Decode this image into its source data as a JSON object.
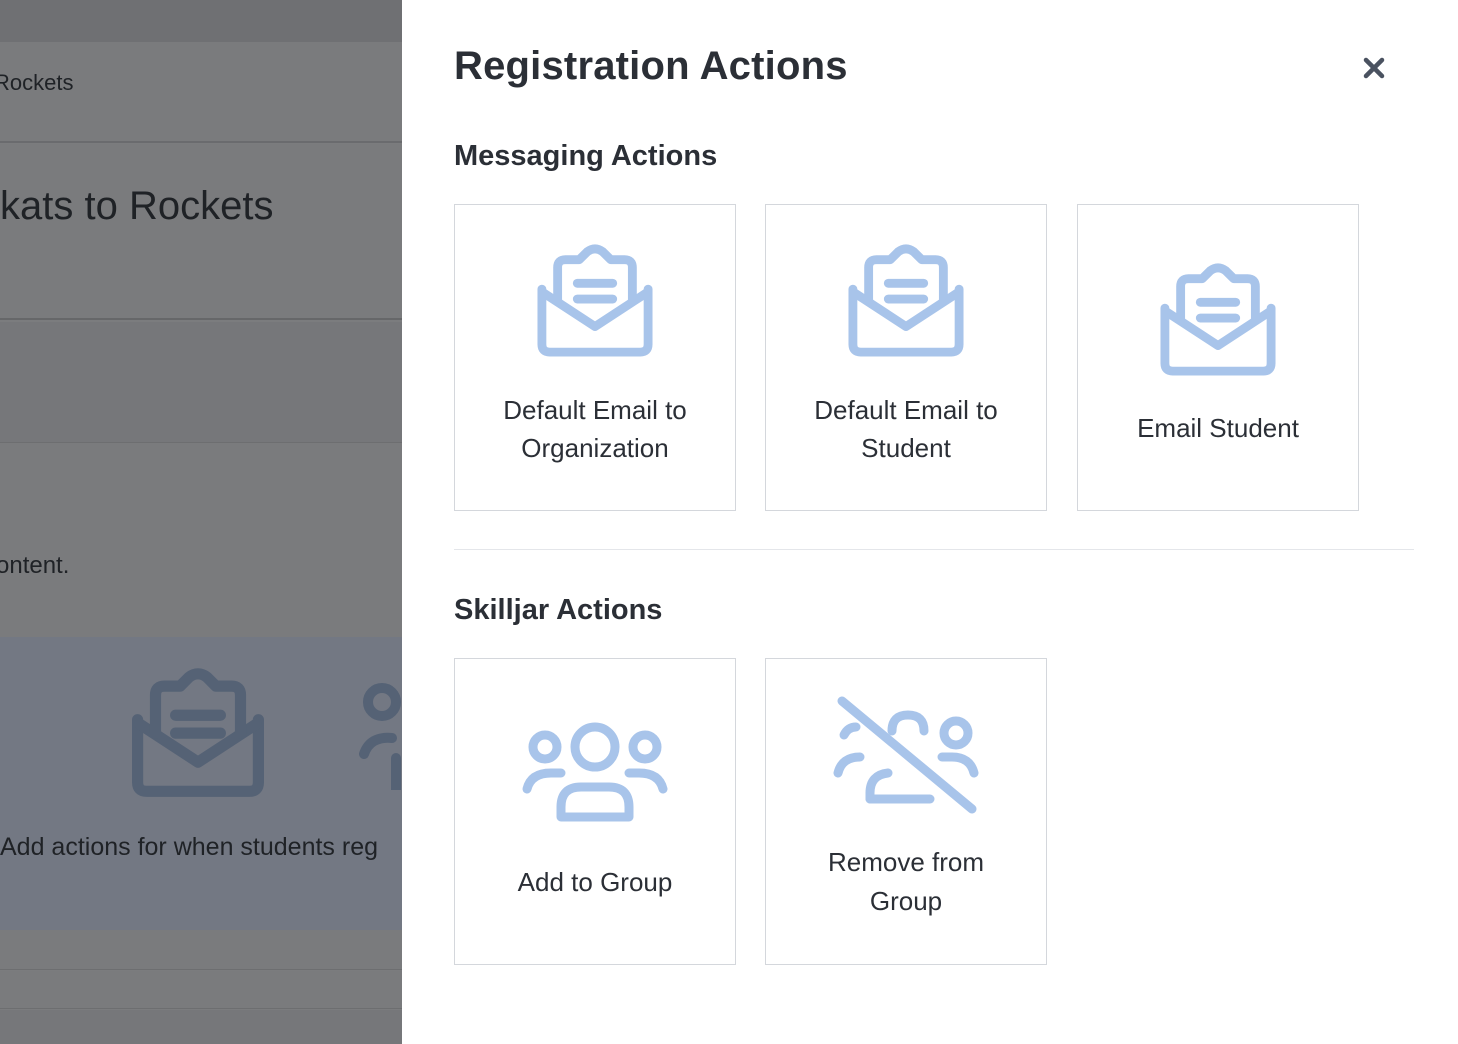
{
  "background": {
    "breadcrumb": "Rockets",
    "title": "kats to Rockets",
    "content_text": "ontent.",
    "hint_text": "Add actions for when students reg"
  },
  "drawer": {
    "title": "Registration Actions",
    "close_icon": "close-icon",
    "sections": [
      {
        "title": "Messaging Actions",
        "cards": [
          {
            "label_line1": "Default Email to",
            "label_line2": "Organization",
            "icon": "envelope-open-icon"
          },
          {
            "label_line1": "Default Email to",
            "label_line2": "Student",
            "icon": "envelope-open-icon"
          },
          {
            "label": "Email Student",
            "icon": "envelope-open-icon"
          }
        ]
      },
      {
        "title": "Skilljar Actions",
        "cards": [
          {
            "label": "Add to Group",
            "icon": "users-group-icon"
          },
          {
            "label_line1": "Remove from",
            "label_line2": "Group",
            "icon": "users-group-slash-icon"
          }
        ]
      }
    ]
  },
  "colors": {
    "icon_blue": "#a8c4ea",
    "overlay_gray": "#7b7c7e",
    "card_border": "#d4d7dc",
    "text_dark": "#2b2f36"
  }
}
